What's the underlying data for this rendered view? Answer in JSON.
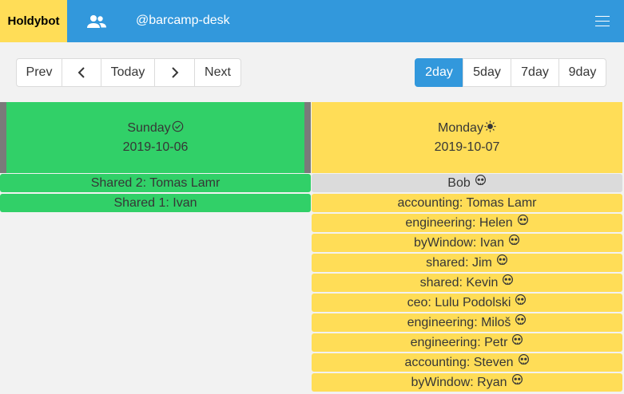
{
  "navbar": {
    "brand": "Holdybot",
    "users_icon": "users-icon",
    "channel": "@barcamp-desk",
    "menu_icon": "hamburger-icon"
  },
  "nav_buttons": {
    "prev": "Prev",
    "prev_icon": "chevron-left-icon",
    "today": "Today",
    "next_icon": "chevron-right-icon",
    "next": "Next"
  },
  "view_buttons": [
    "2day",
    "5day",
    "7day",
    "9day"
  ],
  "view_selected": "2day",
  "days": [
    {
      "name": "Sunday",
      "icon": "check-circle-icon",
      "date": "2019-10-06",
      "color": "#31d068",
      "events": [
        {
          "label": "Shared 2: Tomas Lamr",
          "style": "green",
          "skull": false
        },
        {
          "label": "Shared 1: Ivan",
          "style": "green",
          "skull": false
        }
      ]
    },
    {
      "name": "Monday",
      "icon": "sun-icon",
      "date": "2019-10-07",
      "color": "#ffdd57",
      "events": [
        {
          "label": "Bob",
          "style": "grey",
          "skull": true
        },
        {
          "label": "accounting: Tomas Lamr",
          "style": "yellow",
          "skull": false
        },
        {
          "label": "engineering: Helen",
          "style": "yellow",
          "skull": true
        },
        {
          "label": "byWindow: Ivan",
          "style": "yellow",
          "skull": true
        },
        {
          "label": "shared: Jim",
          "style": "yellow",
          "skull": true
        },
        {
          "label": "shared: Kevin",
          "style": "yellow",
          "skull": true
        },
        {
          "label": "ceo: Lulu Podolski",
          "style": "yellow",
          "skull": true
        },
        {
          "label": "engineering: Miloš",
          "style": "yellow",
          "skull": true
        },
        {
          "label": "engineering: Petr",
          "style": "yellow",
          "skull": true
        },
        {
          "label": "accounting: Steven",
          "style": "yellow",
          "skull": true
        },
        {
          "label": "byWindow: Ryan",
          "style": "yellow",
          "skull": true
        }
      ]
    }
  ]
}
